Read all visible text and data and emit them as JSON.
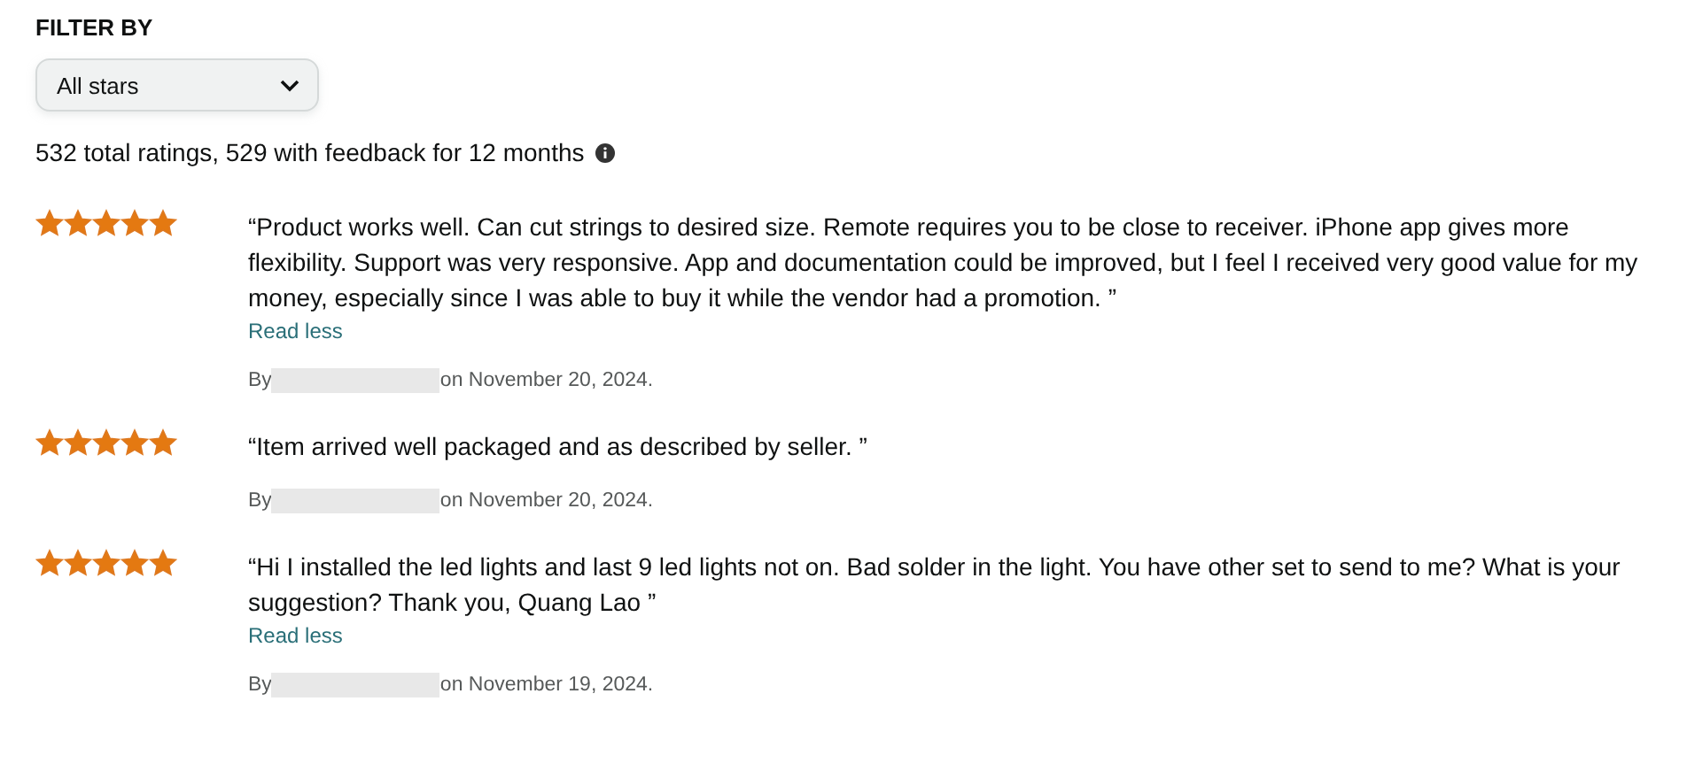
{
  "filter": {
    "heading": "FILTER BY",
    "dropdown": {
      "value": "All stars"
    }
  },
  "summary": "532 total ratings, 529 with feedback for 12 months",
  "reviews": [
    {
      "stars": 5,
      "text": "“Product works well. Can cut strings to desired size. Remote requires you to be close to receiver. iPhone app gives more flexibility. Support was very responsive. App and documentation could be improved, but I feel I received very good value for my money, especially since I was able to buy it while the vendor had a promotion. ”",
      "link": "Read less",
      "by": "By",
      "date": "on November 20, 2024."
    },
    {
      "stars": 5,
      "text": "“Item arrived well packaged and as described by seller. ”",
      "by": "By",
      "date": "on November 20, 2024."
    },
    {
      "stars": 5,
      "text": "“Hi I installed the led lights and last 9 led lights not on. Bad solder in the light. You have other set to send to me? What is your suggestion? Thank you, Quang Lao ”",
      "link": "Read less",
      "by": "By",
      "date": "on November 19, 2024."
    }
  ]
}
